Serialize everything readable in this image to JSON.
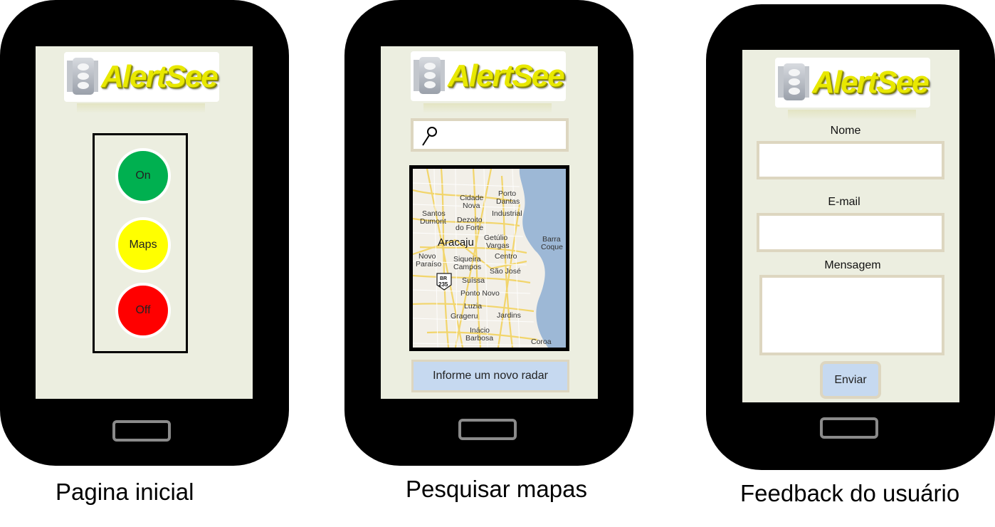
{
  "logo": {
    "text": "AlertSee"
  },
  "screen1": {
    "caption": "Pagina inicial",
    "buttons": [
      {
        "label": "On",
        "color": "#00b050"
      },
      {
        "label": "Maps",
        "color": "#ffff00"
      },
      {
        "label": "Off",
        "color": "#ff0000"
      }
    ]
  },
  "screen2": {
    "caption": "Pesquisar mapas",
    "search_placeholder": "",
    "map_labels": {
      "cidade_nova_1": "Cidade",
      "cidade_nova_2": "Nova",
      "porto_dantas_1": "Porto",
      "porto_dantas_2": "Dantas",
      "industrial": "Industrial",
      "santos_dumont_1": "Santos",
      "santos_dumont_2": "Dumont",
      "dezoito_1": "Dezoito",
      "dezoito_2": "do Forte",
      "aracaju": "Aracaju",
      "getulio_1": "Getúlio",
      "getulio_2": "Vargas",
      "barra_1": "Barra",
      "barra_2": "Coque",
      "novo_paraiso_1": "Novo",
      "novo_paraiso_2": "Paraíso",
      "siqueira_1": "Siqueira",
      "siqueira_2": "Campos",
      "centro": "Centro",
      "sao_jose": "São José",
      "br": "BR",
      "br_num": "235",
      "suissa": "Suíssa",
      "ponto_novo": "Ponto Novo",
      "luzia": "Luzia",
      "grageru": "Grageru",
      "jardins": "Jardins",
      "inacio_1": "Inácio",
      "inacio_2": "Barbosa",
      "coroa": "Coroa"
    },
    "radar_button": "Informe um novo radar"
  },
  "screen3": {
    "caption": "Feedback do usuário",
    "name_label": "Nome",
    "email_label": "E-mail",
    "message_label": "Mensagem",
    "send_button": "Enviar"
  }
}
